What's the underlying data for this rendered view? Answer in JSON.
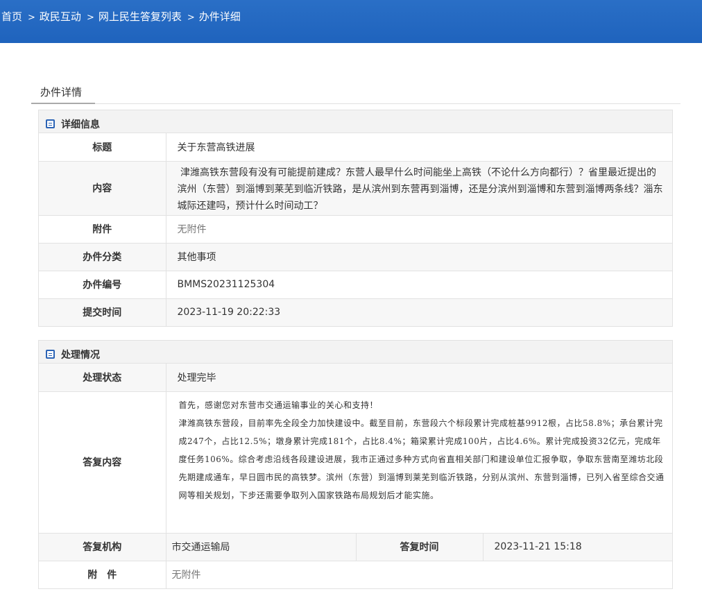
{
  "breadcrumb": {
    "items": [
      "首页",
      "政民互动",
      "网上民生答复列表",
      "办件详细"
    ],
    "separator": ">"
  },
  "tab": {
    "label": "办件详情"
  },
  "detail": {
    "title": "详细信息",
    "rows": {
      "title_label": "标题",
      "title_value": "关于东营高铁进展",
      "content_label": "内容",
      "content_value": "津潍高铁东营段有没有可能提前建成？东营人最早什么时间能坐上高铁（不论什么方向都行）？省里最近提出的滨州（东营）到淄博到莱芜到临沂铁路，是从滨州到东营再到淄博，还是分滨州到淄博和东营到淄博两条线？淄东城际还建吗，预计什么时间动工？",
      "attachment_label": "附件",
      "attachment_value": "无附件",
      "category_label": "办件分类",
      "category_value": "其他事项",
      "number_label": "办件编号",
      "number_value": "BMMS20231125304",
      "submit_label": "提交时间",
      "submit_value": "2023-11-19 20:22:33"
    }
  },
  "processing": {
    "title": "处理情况",
    "status_label": "处理状态",
    "status_value": "处理完毕",
    "reply_label": "答复内容",
    "reply_p1": "首先，感谢您对东营市交通运输事业的关心和支持！",
    "reply_p2": "津潍高铁东营段，目前率先全段全力加快建设中。截至目前，东营段六个标段累计完成桩基9912根，占比58.8%；承台累计完成247个，占比12.5%；墩身累计完成181个，占比8.4%；箱梁累计完成100片，占比4.6%。累计完成投资32亿元，完成年度任务106%。综合考虑沿线各段建设进展，我市正通过多种方式向省直相关部门和建设单位汇报争取，争取东营南至潍坊北段先期建成通车，早日圆市民的高铁梦。滨州（东营）到淄博到莱芜到临沂铁路，分别从滨州、东营到淄博，已列入省至综合交通网等相关规划，下步还需要争取列入国家铁路布局规划后才能实施。",
    "org_label": "答复机构",
    "org_value": "市交通运输局",
    "time_label": "答复时间",
    "time_value": "2023-11-21 15:18",
    "attach_label": "附　件",
    "attach_value": "无附件"
  },
  "colors": {
    "header_blue": "#1f63bd",
    "icon_blue": "#2b63b5"
  },
  "icons": {
    "panel_icon": "list-box-icon"
  }
}
